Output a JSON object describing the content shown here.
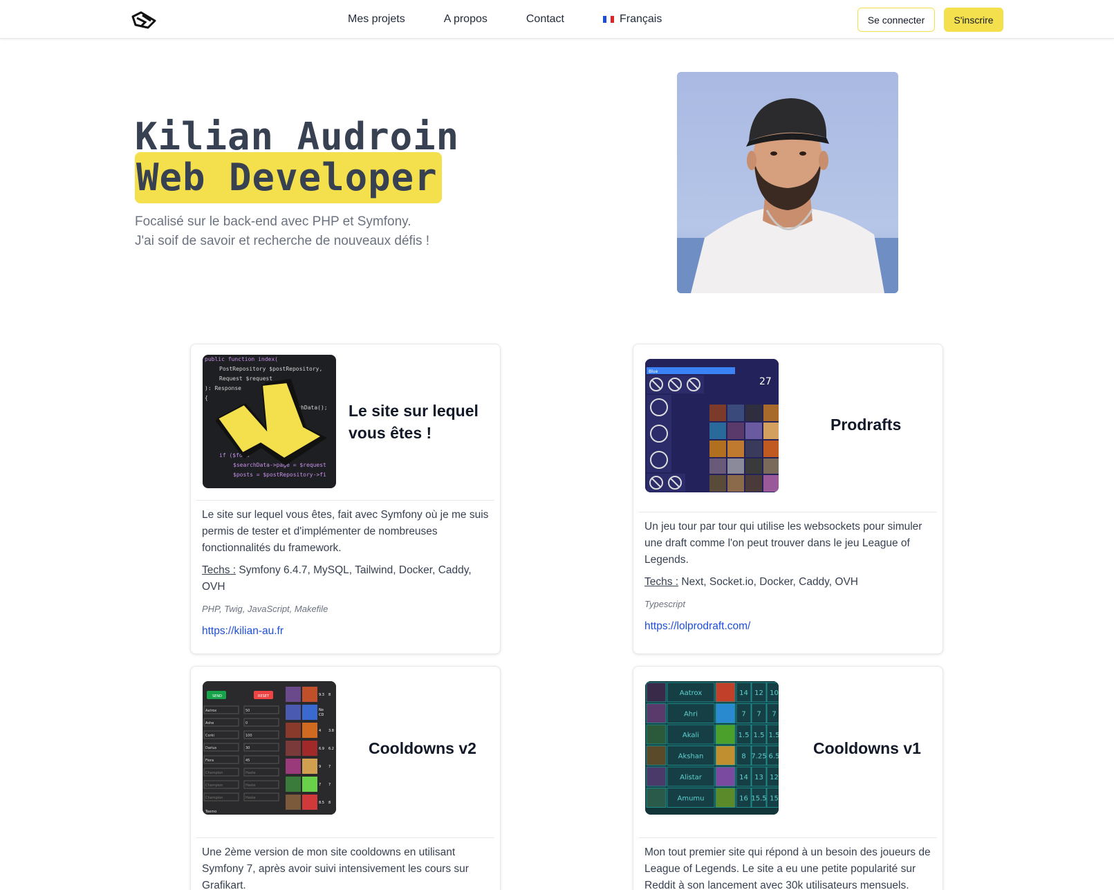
{
  "nav": {
    "links": [
      "Mes projets",
      "A propos",
      "Contact"
    ],
    "language": "Français",
    "login": "Se connecter",
    "signup": "S'inscrire"
  },
  "hero": {
    "name": "Kilian Audroin",
    "role": "Web Developer",
    "subtitle_line1": "Focalisé sur le back-end avec PHP et Symfony.",
    "subtitle_line2": "J'ai soif de savoir et recherche de nouveaux défis !"
  },
  "projects": [
    {
      "title": "Le site sur lequel vous êtes !",
      "description": "Le site sur lequel vous êtes, fait avec Symfony où je me suis permis de tester et d'implémenter de nombreuses fonctionnalités du framework.",
      "techs_label": "Techs :",
      "techs": "Symfony 6.4.7, MySQL, Tailwind, Docker, Caddy, OVH",
      "languages": "PHP, Twig, JavaScript, Makefile",
      "url": "https://kilian-au.fr"
    },
    {
      "title": "Prodrafts",
      "description": "Un jeu tour par tour qui utilise les websockets pour simuler une draft comme l'on peut trouver dans le jeu League of Legends.",
      "techs_label": "Techs :",
      "techs": "Next, Socket.io, Docker, Caddy, OVH",
      "languages": "Typescript",
      "url": "https://lolprodraft.com/"
    },
    {
      "title": "Cooldowns v2",
      "description": "Une 2ème version de mon site cooldowns en utilisant Symfony 7, après avoir suivi intensivement les cours sur Grafikart."
    },
    {
      "title": "Cooldowns v1",
      "description": "Mon tout premier site qui répond à un besoin des joueurs de League of Legends. Le site a eu une petite popularité sur Reddit à son lancement avec 30k utilisateurs mensuels."
    }
  ],
  "thumbs": {
    "code_lines": [
      "public function index(",
      "PostRepository $postRepository,",
      "Request $request",
      "): Response",
      "{",
      "searchData();",
      "if ($form",
      "$searchData->page = $request",
      "$posts = $postRepository->fi"
    ],
    "prodraft_team": "Blue",
    "prodraft_timer": "27",
    "cdv2_send": "SEND",
    "cdv2_reset": "RESET",
    "cdv2_champions": [
      "Aatrox",
      "Ashe",
      "Corki",
      "Darius",
      "Fiora",
      "Champion",
      "Champion",
      "Champion",
      "Teemo"
    ],
    "cdv2_values": [
      "50",
      "0",
      "100",
      "30",
      "45",
      "Haste",
      "Haste",
      "Haste"
    ],
    "cdv2_right_values": [
      [
        "9.3",
        "8"
      ],
      [
        "No",
        "CD"
      ],
      [
        "4",
        "3.8"
      ],
      [
        "6.9",
        "6.2"
      ],
      [
        "9",
        "7"
      ],
      [
        "7",
        "7"
      ],
      [
        "8.5",
        "8"
      ]
    ],
    "cdv1_rows": [
      {
        "name": "Aatrox",
        "v": [
          "14",
          "12",
          "10"
        ]
      },
      {
        "name": "Ahri",
        "v": [
          "7",
          "7",
          "7"
        ]
      },
      {
        "name": "Akali",
        "v": [
          "1.5",
          "1.5",
          "1.5"
        ]
      },
      {
        "name": "Akshan",
        "v": [
          "8",
          "7.25",
          "6.5"
        ]
      },
      {
        "name": "Alistar",
        "v": [
          "14",
          "13",
          "12"
        ]
      },
      {
        "name": "Amumu",
        "v": [
          "16",
          "15.5",
          "15"
        ]
      }
    ]
  },
  "colors": {
    "accent": "#f4e04d",
    "link": "#1d4ed8"
  }
}
